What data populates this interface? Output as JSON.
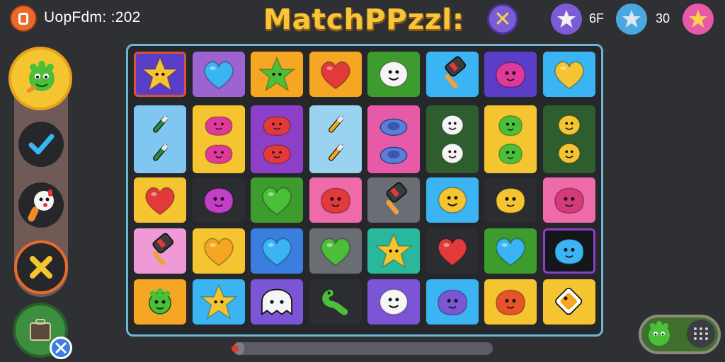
{
  "header": {
    "status_text": "UopFdm: :202",
    "title": "MatchPPzzl:",
    "stats": [
      {
        "icon": "purple-star-icon",
        "value": "6F"
      },
      {
        "icon": "blue-star-icon",
        "value": "30"
      },
      {
        "icon": "pink-star-icon",
        "value": ""
      }
    ]
  },
  "sidebar": {
    "items": [
      {
        "name": "monster-avatar-button"
      },
      {
        "name": "check-button"
      },
      {
        "name": "mascot-button"
      },
      {
        "name": "cancel-button"
      }
    ]
  },
  "board": {
    "columns": 8,
    "rows": 5,
    "tiles": [
      {
        "bg": "#5a3ec8",
        "piece": "star",
        "pc": "#f5c531",
        "border": "#d9533a"
      },
      {
        "bg": "#9d63d1",
        "piece": "heart",
        "pc": "#3ab4f2"
      },
      {
        "bg": "#f5a623",
        "piece": "star",
        "pc": "#4cbf3a"
      },
      {
        "bg": "#f5a623",
        "piece": "heart",
        "pc": "#e23a3a"
      },
      {
        "bg": "#3e9b2e",
        "piece": "face",
        "pc": "#f5f5f5"
      },
      {
        "bg": "#3ab4f2",
        "piece": "hammer",
        "pc": "#3b3b3b"
      },
      {
        "bg": "#5a3ec8",
        "piece": "blob",
        "pc": "#e0399a"
      },
      {
        "bg": "#3ab4f2",
        "piece": "heart",
        "pc": "#f5c531"
      },
      {
        "bg": "#7fc7f0",
        "piece": "brush",
        "pc": "#2f8c2f",
        "tall": true
      },
      {
        "bg": "#f5c531",
        "piece": "blob2",
        "pc": "#e0399a",
        "tall": true
      },
      {
        "bg": "#8d3fc8",
        "piece": "blob2",
        "pc": "#e23a3a",
        "tall": true
      },
      {
        "bg": "#9ad3f0",
        "piece": "brush",
        "pc": "#f5a623",
        "tall": true
      },
      {
        "bg": "#e65aa8",
        "piece": "cap",
        "pc": "#5a7fd6",
        "tall": true
      },
      {
        "bg": "#2e5d2e",
        "piece": "face",
        "pc": "#f5f5f5",
        "tall": true
      },
      {
        "bg": "#f5c531",
        "piece": "blob",
        "pc": "#4cbf3a",
        "tall": true
      },
      {
        "bg": "#2e5d2e",
        "piece": "face",
        "pc": "#f5c531",
        "tall": true
      },
      {
        "bg": "#f5c531",
        "piece": "heart",
        "pc": "#e23a3a"
      },
      {
        "bg": "#2b2d31",
        "piece": "blob",
        "pc": "#c43fc8"
      },
      {
        "bg": "#3e9b2e",
        "piece": "heart",
        "pc": "#4cbf3a"
      },
      {
        "bg": "#ef6aa8",
        "piece": "blob",
        "pc": "#e23a3a"
      },
      {
        "bg": "#6a6d73",
        "piece": "hammer",
        "pc": "#3b3b3b"
      },
      {
        "bg": "#3ab4f2",
        "piece": "face",
        "pc": "#f5c531"
      },
      {
        "bg": "#2b2d31",
        "piece": "blob",
        "pc": "#f5c531"
      },
      {
        "bg": "#ef6aa8",
        "piece": "blob",
        "pc": "#d23a7a"
      },
      {
        "bg": "#ef9ad6",
        "piece": "hammer",
        "pc": "#3b3b3b"
      },
      {
        "bg": "#f5c531",
        "piece": "heart",
        "pc": "#f5a623"
      },
      {
        "bg": "#3a7fe0",
        "piece": "heart",
        "pc": "#3ab4f2"
      },
      {
        "bg": "#6a6d73",
        "piece": "heart",
        "pc": "#4cbf3a"
      },
      {
        "bg": "#2ab89c",
        "piece": "star",
        "pc": "#f5c531"
      },
      {
        "bg": "#2b2d31",
        "piece": "heart",
        "pc": "#e23a3a"
      },
      {
        "bg": "#3e9b2e",
        "piece": "heart",
        "pc": "#3ab4f2"
      },
      {
        "bg": "#15161a",
        "piece": "blob",
        "pc": "#3ab4f2",
        "border": "#8d3fc8"
      },
      {
        "bg": "#f5a623",
        "piece": "monster",
        "pc": "#4cbf3a"
      },
      {
        "bg": "#3ab4f2",
        "piece": "star",
        "pc": "#f5c531"
      },
      {
        "bg": "#7b55d6",
        "piece": "ghost",
        "pc": "#f5f5f5"
      },
      {
        "bg": "#2b2d31",
        "piece": "worm",
        "pc": "#4cbf3a"
      },
      {
        "bg": "#7b55d6",
        "piece": "face",
        "pc": "#f5f5f5"
      },
      {
        "bg": "#3ab4f2",
        "piece": "blob",
        "pc": "#7b55d6"
      },
      {
        "bg": "#f5c531",
        "piece": "blob",
        "pc": "#e8542a"
      },
      {
        "bg": "#f5c531",
        "piece": "tag",
        "pc": "#f5a623"
      }
    ]
  },
  "progress": {
    "value": 0.04
  },
  "colors": {
    "accent": "#f7c43a",
    "frame": "#6fb6d6",
    "background": "#2f3033"
  }
}
